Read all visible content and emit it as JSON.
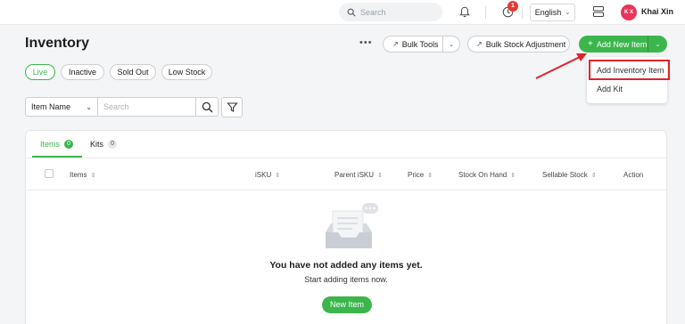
{
  "topbar": {
    "search_placeholder": "Search",
    "notification_count": "1",
    "language": "English",
    "avatar_initials": "K X",
    "username": "Khai Xin"
  },
  "header": {
    "title": "Inventory",
    "more_label": "•••",
    "bulk_tools": "Bulk Tools",
    "bulk_stock": "Bulk Stock Adjustment",
    "add_new": "Add New Item"
  },
  "add_menu": {
    "items": [
      "Add Inventory Item",
      "Add Kit"
    ]
  },
  "filters": {
    "chips": [
      "Live",
      "Inactive",
      "Sold Out",
      "Low Stock"
    ],
    "active": "Live"
  },
  "search": {
    "field": "Item Name",
    "placeholder": "Search"
  },
  "tabs": [
    {
      "label": "Items",
      "count": "0"
    },
    {
      "label": "Kits",
      "count": "0"
    }
  ],
  "table": {
    "columns": [
      "Items",
      "iSKU",
      "Parent iSKU",
      "Price",
      "Stock On Hand",
      "Sellable Stock",
      "Action"
    ]
  },
  "empty": {
    "title": "You have not added any items yet.",
    "subtitle": "Start adding items now.",
    "button": "New Item"
  },
  "colors": {
    "accent": "#3cb64c",
    "highlight": "#e0242a",
    "badge": "#e53935",
    "avatar": "#e8355a"
  }
}
